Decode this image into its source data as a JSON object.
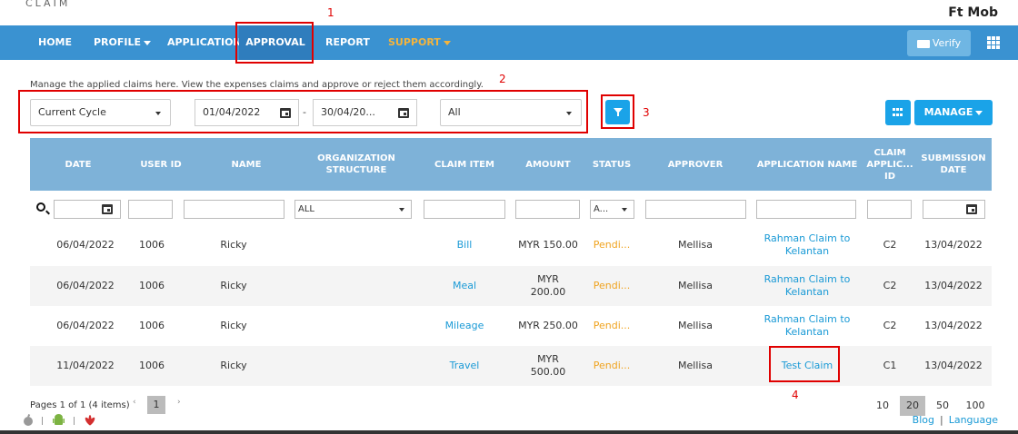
{
  "header": {
    "logo_text": "CLAIM",
    "company": "Ft Mob",
    "colors": {
      "nav_bg": "#3a92d1",
      "accent": "#1aa3e8",
      "pending": "#f0a31e",
      "link": "#1a9ad6",
      "annotation": "#e00000"
    }
  },
  "annotations": {
    "a1": "1",
    "a2": "2",
    "a3": "3",
    "a4": "4"
  },
  "nav": {
    "home": "HOME",
    "profile": "PROFILE",
    "application": "APPLICATION",
    "approval": "APPROVAL",
    "report": "REPORT",
    "support": "SUPPORT",
    "verify": "Verify"
  },
  "page": {
    "description": "Manage the applied claims here. View the expenses claims and approve or reject them accordingly."
  },
  "filters": {
    "cycle": "Current Cycle",
    "date_from": "01/04/2022",
    "date_separator": "-",
    "date_to": "30/04/20...",
    "status": "All",
    "manage": "MANAGE"
  },
  "table": {
    "headers": {
      "date": "DATE",
      "user_id": "USER ID",
      "name": "NAME",
      "org": "ORGANIZATION STRUCTURE",
      "claim_item": "CLAIM ITEM",
      "amount": "AMOUNT",
      "status": "STATUS",
      "approver": "APPROVER",
      "app_name": "APPLICATION NAME",
      "claim_app_id": "CLAIM APPLIC... ID",
      "submission": "SUBMISSION DATE"
    },
    "column_filters": {
      "org": "ALL",
      "status": "A..."
    },
    "rows": [
      {
        "date": "06/04/2022",
        "user_id": "1006",
        "name": "Ricky",
        "org": "",
        "claim_item": "Bill",
        "amount": "MYR 150.00",
        "status": "Pendi...",
        "approver": "Mellisa",
        "app_name": "Rahman Claim to Kelantan",
        "claim_app_id": "C2",
        "submission": "13/04/2022"
      },
      {
        "date": "06/04/2022",
        "user_id": "1006",
        "name": "Ricky",
        "org": "",
        "claim_item": "Meal",
        "amount": "MYR 200.00",
        "status": "Pendi...",
        "approver": "Mellisa",
        "app_name": "Rahman Claim to Kelantan",
        "claim_app_id": "C2",
        "submission": "13/04/2022"
      },
      {
        "date": "06/04/2022",
        "user_id": "1006",
        "name": "Ricky",
        "org": "",
        "claim_item": "Mileage",
        "amount": "MYR 250.00",
        "status": "Pendi...",
        "approver": "Mellisa",
        "app_name": "Rahman Claim to Kelantan",
        "claim_app_id": "C2",
        "submission": "13/04/2022"
      },
      {
        "date": "11/04/2022",
        "user_id": "1006",
        "name": "Ricky",
        "org": "",
        "claim_item": "Travel",
        "amount": "MYR 500.00",
        "status": "Pendi...",
        "approver": "Mellisa",
        "app_name": "Test Claim",
        "claim_app_id": "C1",
        "submission": "13/04/2022"
      }
    ]
  },
  "pager": {
    "info": "Pages 1 of 1 (4 items)",
    "prev": "‹",
    "next": "›",
    "current": "1",
    "sizes": [
      "10",
      "20",
      "50",
      "100"
    ],
    "selected_size": "20"
  },
  "footer": {
    "blog": "Blog",
    "separator": "|",
    "language": "Language",
    "icons": [
      "apple-icon",
      "android-icon",
      "huawei-icon"
    ]
  }
}
